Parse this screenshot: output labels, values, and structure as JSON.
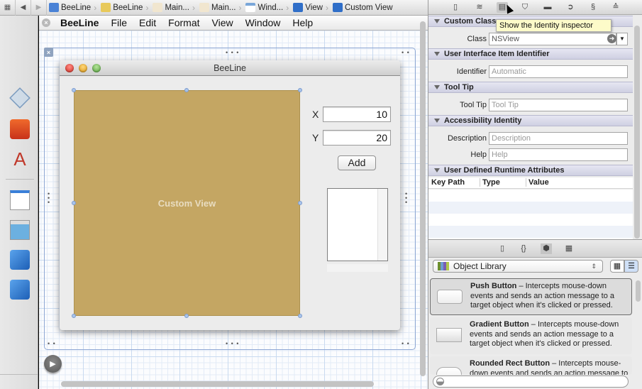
{
  "jumpbar": {
    "breadcrumbs": [
      {
        "label": "BeeLine",
        "icon": "xcode-project-icon"
      },
      {
        "label": "BeeLine",
        "icon": "folder-icon"
      },
      {
        "label": "Main...",
        "icon": "xib-file-icon"
      },
      {
        "label": "Main...",
        "icon": "xib-file-icon"
      },
      {
        "label": "Wind...",
        "icon": "window-icon"
      },
      {
        "label": "View",
        "icon": "view-icon"
      },
      {
        "label": "Custom View",
        "icon": "view-icon"
      }
    ]
  },
  "menubar": {
    "app": "BeeLine",
    "items": [
      "File",
      "Edit",
      "Format",
      "View",
      "Window",
      "Help"
    ]
  },
  "app_window": {
    "title": "BeeLine",
    "custom_view_label": "Custom View",
    "x_label": "X",
    "x_value": "10",
    "y_label": "Y",
    "y_value": "20",
    "add_button": "Add"
  },
  "tooltip": "Show the Identity inspector",
  "inspector": {
    "sections": [
      {
        "title": "Custom Class",
        "fields": [
          {
            "label": "Class",
            "value": "NSView"
          }
        ]
      },
      {
        "title": "User Interface Item Identifier",
        "fields": [
          {
            "label": "Identifier",
            "placeholder": "Automatic"
          }
        ]
      },
      {
        "title": "Tool Tip",
        "fields": [
          {
            "label": "Tool Tip",
            "placeholder": "Tool Tip"
          }
        ]
      },
      {
        "title": "Accessibility Identity",
        "fields": [
          {
            "label": "Description",
            "placeholder": "Description"
          },
          {
            "label": "Help",
            "placeholder": "Help"
          }
        ]
      },
      {
        "title": "User Defined Runtime Attributes",
        "columns": [
          "Key Path",
          "Type",
          "Value"
        ]
      }
    ]
  },
  "library": {
    "selector": "Object Library",
    "items": [
      {
        "name": "Push Button",
        "desc": " – Intercepts mouse-down events and sends an action message to a target object when it's clicked or pressed."
      },
      {
        "name": "Gradient Button",
        "desc": " – Intercepts mouse-down events and sends an action message to a target object when it's clicked or pressed."
      },
      {
        "name": "Rounded Rect Button",
        "desc": " – Intercepts mouse-down events and sends an action message to"
      }
    ]
  }
}
